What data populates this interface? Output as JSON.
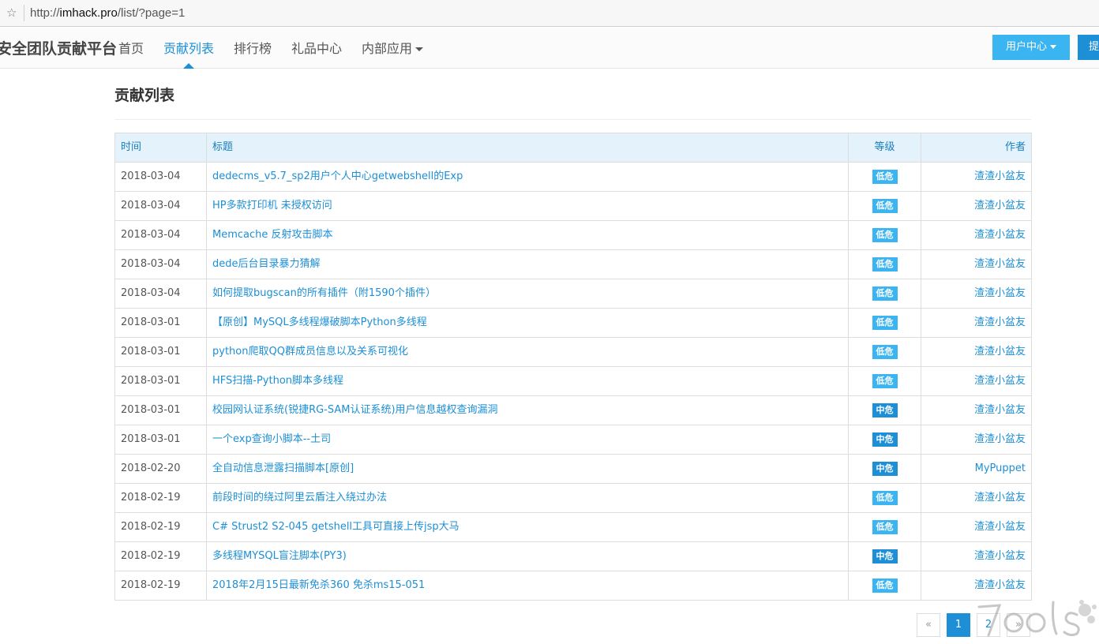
{
  "browser": {
    "url_prefix": "http://",
    "url_host": "imhack.pro",
    "url_path": "/list/?page=1"
  },
  "nav": {
    "brand": "安全团队贡献平台",
    "items": [
      "首页",
      "贡献列表",
      "排行榜",
      "礼品中心",
      "内部应用"
    ],
    "active_index": 1,
    "user_center": "用户中心",
    "submit": "提交"
  },
  "page": {
    "title": "贡献列表"
  },
  "table": {
    "headers": {
      "time": "时间",
      "title": "标题",
      "level": "等级",
      "author": "作者"
    },
    "rows": [
      {
        "time": "2018-03-04",
        "title": "dedecms_v5.7_sp2用户个人中心getwebshell的Exp",
        "level": "低危",
        "author": "渣渣小盆友"
      },
      {
        "time": "2018-03-04",
        "title": "HP多款打印机 未授权访问",
        "level": "低危",
        "author": "渣渣小盆友"
      },
      {
        "time": "2018-03-04",
        "title": "Memcache 反射攻击脚本",
        "level": "低危",
        "author": "渣渣小盆友"
      },
      {
        "time": "2018-03-04",
        "title": "dede后台目录暴力猜解",
        "level": "低危",
        "author": "渣渣小盆友"
      },
      {
        "time": "2018-03-04",
        "title": "如何提取bugscan的所有插件（附1590个插件）",
        "level": "低危",
        "author": "渣渣小盆友"
      },
      {
        "time": "2018-03-01",
        "title": "【原创】MySQL多线程爆破脚本Python多线程",
        "level": "低危",
        "author": "渣渣小盆友"
      },
      {
        "time": "2018-03-01",
        "title": "python爬取QQ群成员信息以及关系可视化",
        "level": "低危",
        "author": "渣渣小盆友"
      },
      {
        "time": "2018-03-01",
        "title": "HFS扫描-Python脚本多线程",
        "level": "低危",
        "author": "渣渣小盆友"
      },
      {
        "time": "2018-03-01",
        "title": "校园网认证系统(锐捷RG-SAM认证系统)用户信息越权查询漏洞",
        "level": "中危",
        "author": "渣渣小盆友"
      },
      {
        "time": "2018-03-01",
        "title": "一个exp查询小脚本--土司",
        "level": "中危",
        "author": "渣渣小盆友"
      },
      {
        "time": "2018-02-20",
        "title": "全自动信息泄露扫描脚本[原创]",
        "level": "中危",
        "author": "MyPuppet"
      },
      {
        "time": "2018-02-19",
        "title": "前段时间的绕过阿里云盾注入绕过办法",
        "level": "低危",
        "author": "渣渣小盆友"
      },
      {
        "time": "2018-02-19",
        "title": "C# Strust2 S2-045 getshell工具可直接上传jsp大马",
        "level": "低危",
        "author": "渣渣小盆友"
      },
      {
        "time": "2018-02-19",
        "title": "多线程MYSQL盲注脚本(PY3)",
        "level": "中危",
        "author": "渣渣小盆友"
      },
      {
        "time": "2018-02-19",
        "title": "2018年2月15日最新免杀360 免杀ms15-051",
        "level": "低危",
        "author": "渣渣小盆友"
      }
    ]
  },
  "level_colors": {
    "低危": "#3bb4f2",
    "中危": "#1c8fd6"
  },
  "pagination": {
    "prev": "«",
    "pages": [
      "1",
      "2"
    ],
    "current": "1",
    "next": "»"
  },
  "watermark": {
    "text": "7ools"
  },
  "colors": {
    "accent": "#1c8fd6",
    "accent_light": "#3bb4f2",
    "header_bg": "#e3f2fb"
  }
}
